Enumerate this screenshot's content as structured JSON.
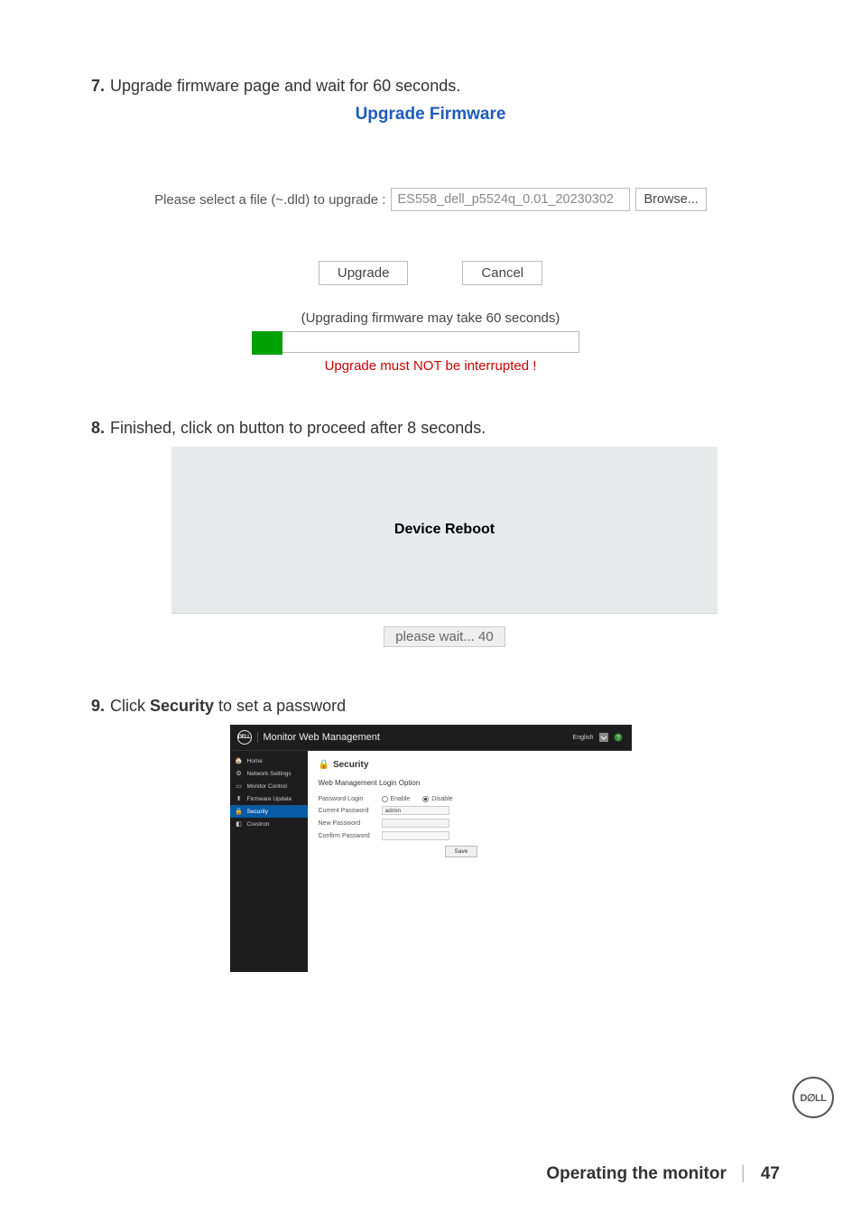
{
  "step7": {
    "number": "7.",
    "text": "Upgrade firmware page and wait for 60 seconds.",
    "upgrade": {
      "title": "Upgrade Firmware",
      "file_label": "Please select a file (~.dld) to upgrade :",
      "file_value": "ES558_dell_p5524q_0.01_20230302",
      "browse": "Browse...",
      "upgrade_btn": "Upgrade",
      "cancel_btn": "Cancel",
      "note": "(Upgrading firmware may take 60 seconds)",
      "warning": "Upgrade must NOT be interrupted !"
    }
  },
  "step8": {
    "number": "8.",
    "text": "Finished, click on button to proceed after 8 seconds.",
    "reboot_title": "Device Reboot",
    "please_wait": "please wait... 40"
  },
  "step9": {
    "number": "9.",
    "text_prefix": "Click ",
    "text_bold": "Security",
    "text_suffix": " to set a password",
    "header_brand": "DELL",
    "header_title": "Monitor Web Management",
    "header_lang": "English",
    "sidebar": {
      "items": [
        {
          "icon": "🏠",
          "label": "Home"
        },
        {
          "icon": "⚙",
          "label": "Network Settings"
        },
        {
          "icon": "▭",
          "label": "Monitor Control"
        },
        {
          "icon": "⬆",
          "label": "Firmware Update"
        },
        {
          "icon": "🔒",
          "label": "Security"
        },
        {
          "icon": "◧",
          "label": "Crestron"
        }
      ]
    },
    "main": {
      "title_icon": "🔒",
      "title": "Security",
      "subtitle": "Web Management Login Option",
      "password_login_label": "Password Login",
      "enable_label": "Enable",
      "disable_label": "Disable",
      "current_password_label": "Current Password",
      "current_password_value": "admin",
      "new_password_label": "New Password",
      "confirm_password_label": "Confirm Password",
      "save_btn": "Save"
    }
  },
  "footer": {
    "title": "Operating the monitor",
    "divider": "│",
    "page": "47"
  },
  "colors": {
    "blue_title": "#1f5bbf",
    "red_warning": "#d00000",
    "green_progress": "#00a000",
    "sidebar_active": "#0a5aa5"
  }
}
